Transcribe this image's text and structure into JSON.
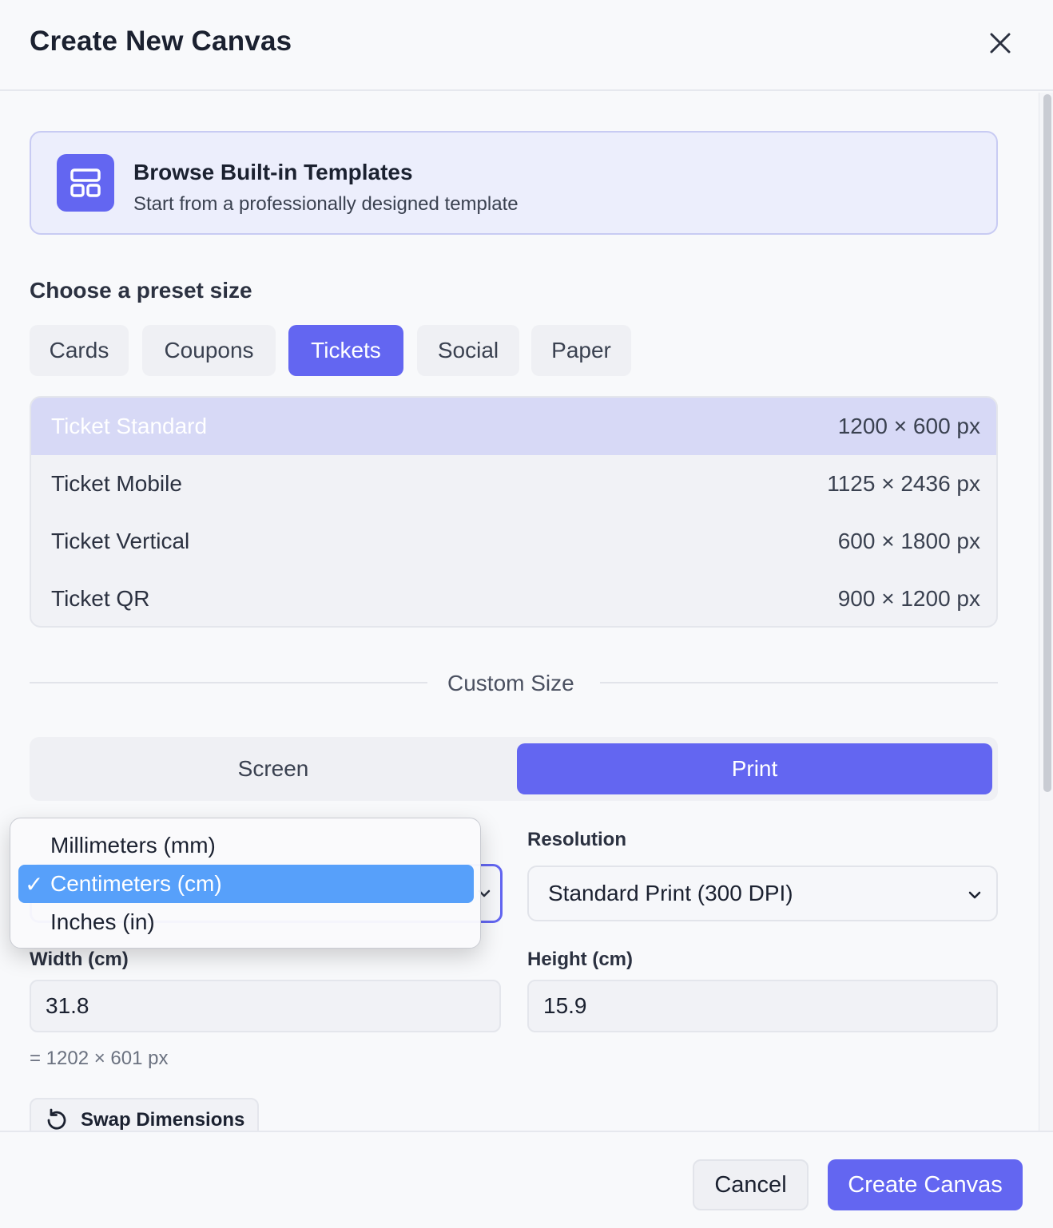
{
  "dialog": {
    "title": "Create New Canvas",
    "close_icon": "close-icon"
  },
  "templates": {
    "icon": "layout-template-icon",
    "title": "Browse Built-in Templates",
    "subtitle": "Start from a professionally designed template"
  },
  "presets": {
    "label": "Choose a preset size",
    "tabs": [
      {
        "label": "Cards",
        "active": false
      },
      {
        "label": "Coupons",
        "active": false
      },
      {
        "label": "Tickets",
        "active": true
      },
      {
        "label": "Social",
        "active": false
      },
      {
        "label": "Paper",
        "active": false
      }
    ],
    "items": [
      {
        "name": "Ticket Standard",
        "size": "1200 × 600 px",
        "selected": true
      },
      {
        "name": "Ticket Mobile",
        "size": "1125 × 2436 px",
        "selected": false
      },
      {
        "name": "Ticket Vertical",
        "size": "600 × 1800 px",
        "selected": false
      },
      {
        "name": "Ticket QR",
        "size": "900 × 1200 px",
        "selected": false
      }
    ]
  },
  "custom": {
    "label": "Custom Size",
    "modes": [
      {
        "label": "Screen",
        "active": false
      },
      {
        "label": "Print",
        "active": true
      }
    ],
    "units": {
      "options": [
        {
          "label": "Millimeters (mm)",
          "selected": false
        },
        {
          "label": "Centimeters (cm)",
          "selected": true
        },
        {
          "label": "Inches (in)",
          "selected": false
        }
      ],
      "check_glyph": "✓"
    },
    "resolution": {
      "label": "Resolution",
      "value": "Standard Print (300 DPI)"
    },
    "width": {
      "label": "Width (cm)",
      "value": "31.8"
    },
    "height": {
      "label": "Height (cm)",
      "value": "15.9"
    },
    "px_note": "= 1202 × 601 px",
    "swap_label": "Swap Dimensions",
    "swap_icon": "rotate-ccw-icon"
  },
  "footer": {
    "cancel_label": "Cancel",
    "create_label": "Create Canvas"
  },
  "colors": {
    "accent": "#6366f1",
    "dropdown_highlight": "#57a0fa"
  }
}
